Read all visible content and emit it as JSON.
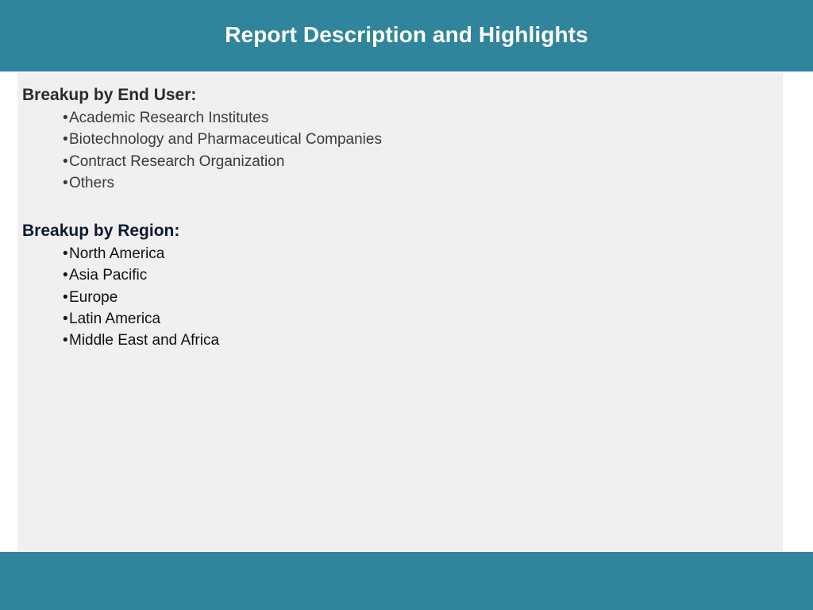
{
  "header": {
    "title": "Report Description and Highlights"
  },
  "sections": [
    {
      "heading": "Breakup by End User:",
      "items": [
        "Academic Research Institutes",
        "Biotechnology and Pharmaceutical Companies",
        "Contract Research Organization",
        "Others"
      ]
    },
    {
      "heading": "Breakup by Region:",
      "items": [
        "North America",
        "Asia Pacific",
        "Europe",
        "Latin America",
        "Middle East and Africa"
      ]
    }
  ],
  "bullet_symbol": "•",
  "colors": {
    "header_bg": "#30849b",
    "footer_bg": "#30849b",
    "panel_bg": "#f0f0f0",
    "title_text": "#ffffff"
  }
}
